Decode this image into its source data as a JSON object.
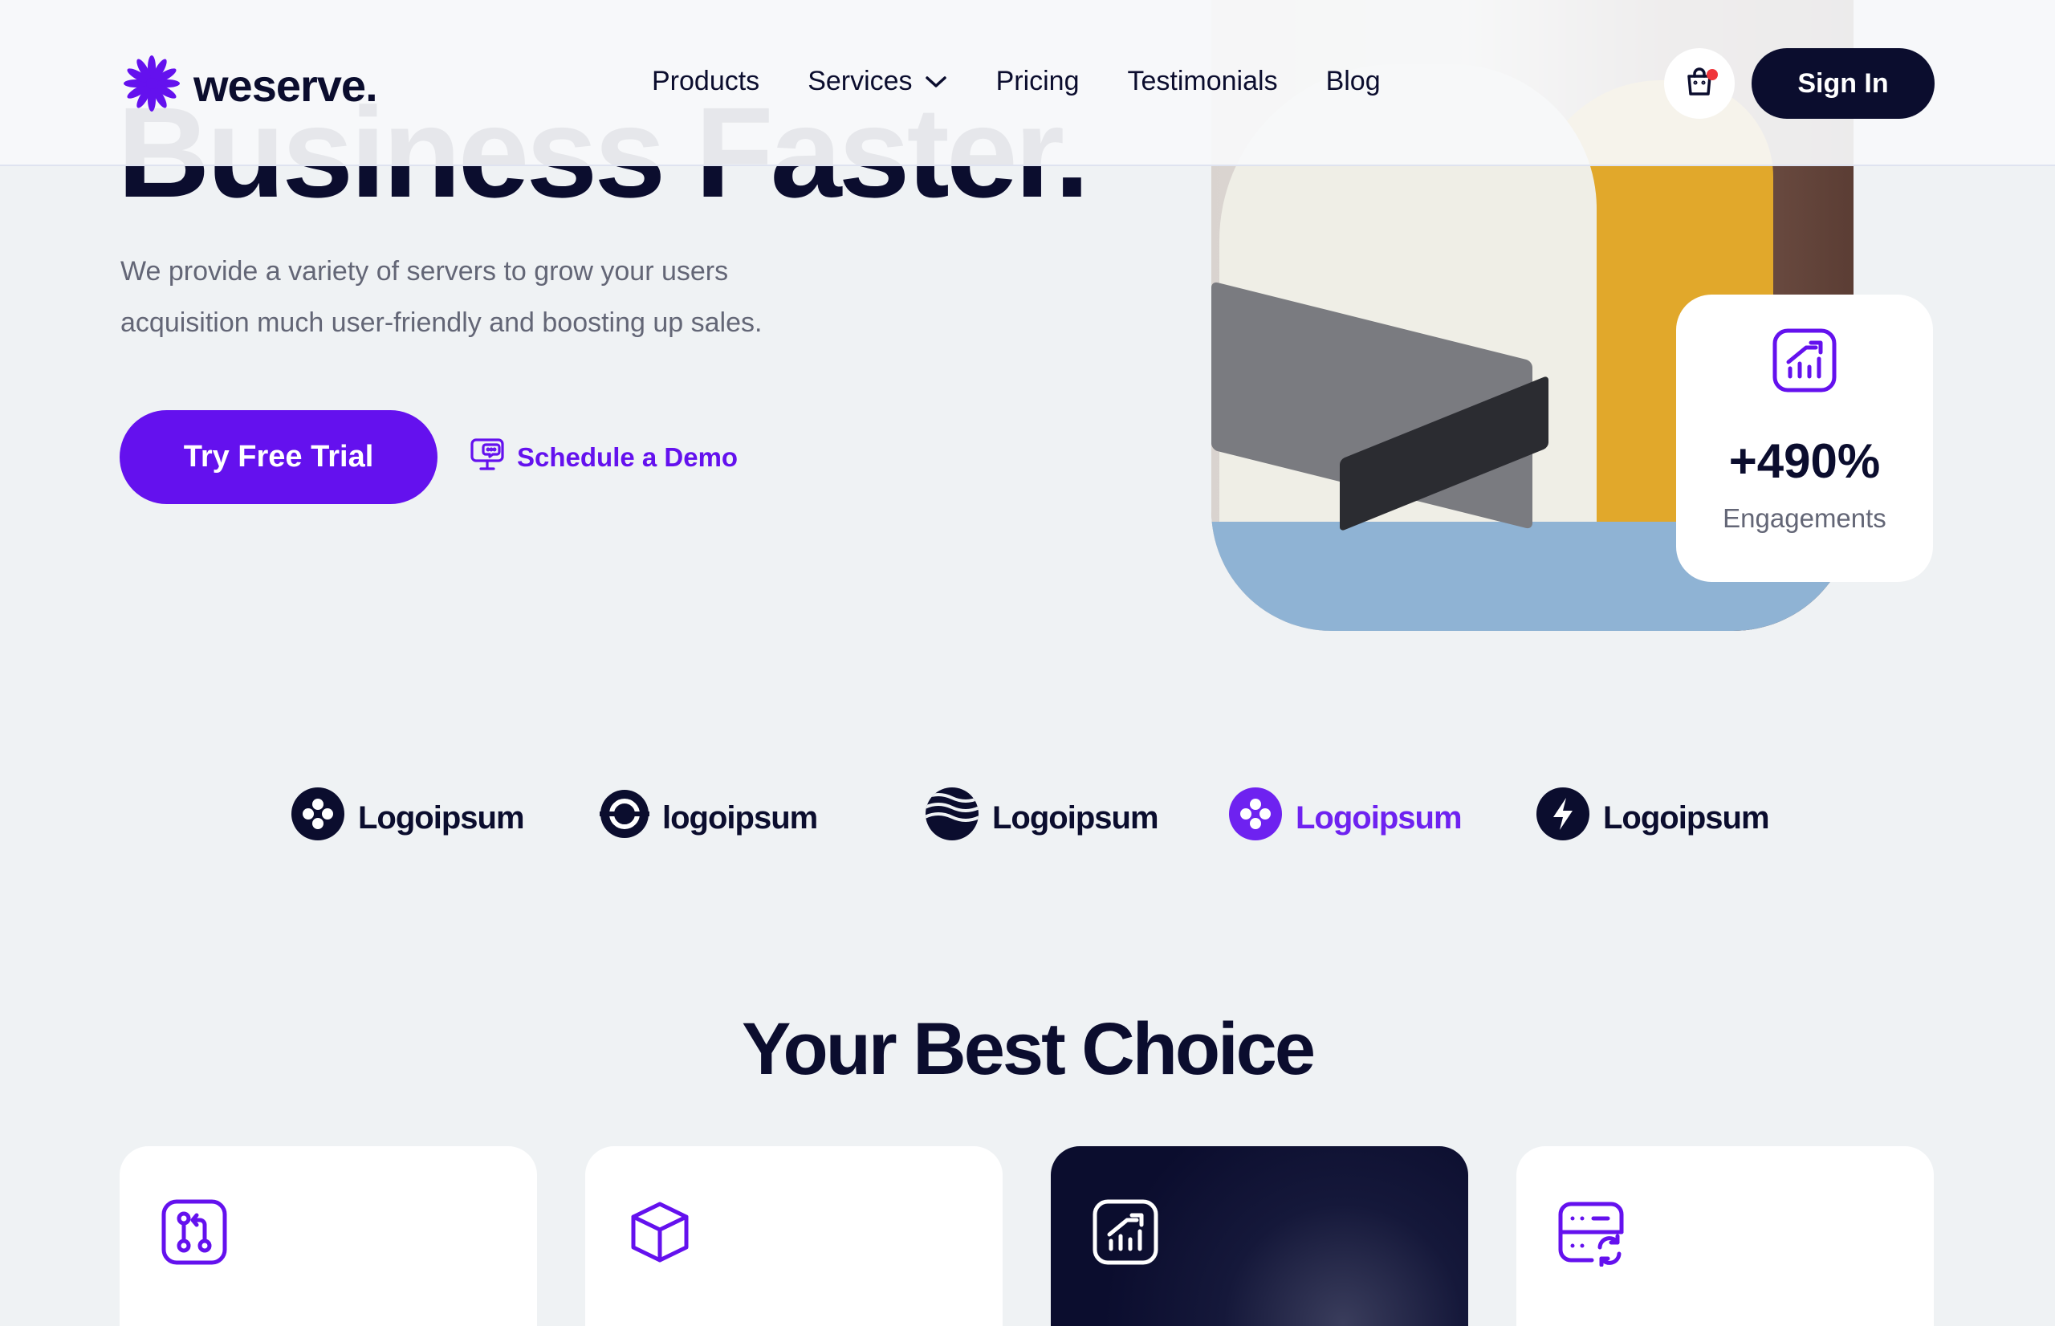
{
  "colors": {
    "background": "#eff2f4",
    "primary": "#6411ee",
    "navy": "#0b0d2e",
    "muted": "#636676",
    "notification": "#f0353a"
  },
  "header": {
    "logo_text": "weserve.",
    "nav": [
      {
        "label": "Products"
      },
      {
        "label": "Services",
        "icon": "chevron-down-icon"
      },
      {
        "label": "Pricing"
      },
      {
        "label": "Testimonials"
      },
      {
        "label": "Blog"
      }
    ],
    "cart_icon": "shopping-bag-icon",
    "signin_label": "Sign In"
  },
  "hero": {
    "title_partial": "Business Faster.",
    "subtitle_line1": "We provide a variety of servers to grow your users",
    "subtitle_line2": "acquisition much user-friendly and boosting up sales.",
    "trial_label": "Try Free Trial",
    "demo_label": "Schedule a Demo",
    "demo_icon": "presentation-chat-icon"
  },
  "stat": {
    "icon": "chart-growth-icon",
    "value": "+490%",
    "label": "Engagements"
  },
  "partner_logos": [
    {
      "name": "Logoipsum",
      "icon": "clover-icon"
    },
    {
      "name": "logoipsum",
      "icon": "ring-icon"
    },
    {
      "name": "Logoipsum",
      "icon": "waves-icon"
    },
    {
      "name": "Logoipsum",
      "icon": "clover-icon"
    },
    {
      "name": "Logoipsum",
      "icon": "bolt-icon"
    }
  ],
  "section": {
    "title": "Your Best Choice",
    "cards": [
      {
        "icon": "git-pull-request-icon"
      },
      {
        "icon": "cube-icon"
      },
      {
        "icon": "chart-growth-icon"
      },
      {
        "icon": "server-sync-icon"
      }
    ]
  }
}
